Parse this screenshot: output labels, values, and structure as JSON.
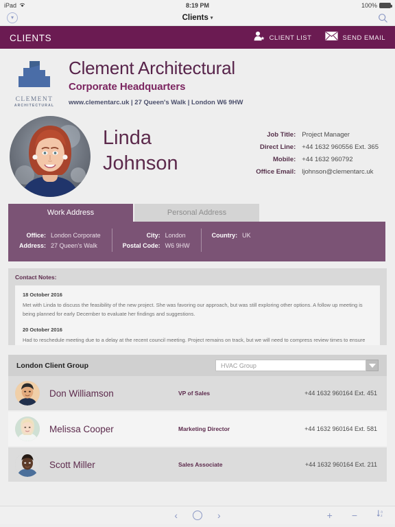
{
  "status_bar": {
    "device": "iPad",
    "wifi_icon": "wifi-icon",
    "time": "8:19 PM",
    "battery_percent": "100%"
  },
  "chrome": {
    "back_icon": "chevron-down-circle-icon",
    "title": "Clients",
    "title_caret": "▾",
    "search_icon": "search-icon"
  },
  "appbar": {
    "title": "CLIENTS",
    "actions": [
      {
        "label": "CLIENT LIST",
        "icon": "client-list-person-icon"
      },
      {
        "label": "SEND EMAIL",
        "icon": "envelope-icon"
      }
    ]
  },
  "company": {
    "logo_icon": "building-logo-icon",
    "logo_word_1": "CLEMENT",
    "logo_word_2": "ARCHITECTURAL",
    "name": "Clement Architectural",
    "subtitle": "Corporate Headquarters",
    "meta": "www.clementarc.uk | 27 Queen's Walk | London W6 9HW"
  },
  "person": {
    "avatar_icon": "contact-photo-avatar",
    "first_name": "Linda",
    "last_name": "Johnson",
    "details": [
      {
        "key": "Job Title:",
        "value": "Project Manager"
      },
      {
        "key": "Direct Line:",
        "value": "+44 1632 960556  Ext. 365"
      },
      {
        "key": "Mobile:",
        "value": "+44 1632 960792"
      },
      {
        "key": "Office Email:",
        "value": "ljohnson@clementarc.uk"
      }
    ]
  },
  "address": {
    "tabs": [
      {
        "label": "Work Address",
        "active": true
      },
      {
        "label": "Personal Address",
        "active": false
      }
    ],
    "columns": [
      {
        "rows": [
          {
            "key": "Office:",
            "value": "London Corporate"
          },
          {
            "key": "Address:",
            "value": "27 Queen's Walk"
          }
        ]
      },
      {
        "rows": [
          {
            "key": "City:",
            "value": "London"
          },
          {
            "key": "Postal Code:",
            "value": "W6 9HW"
          }
        ]
      },
      {
        "rows": [
          {
            "key": "Country:",
            "value": "UK"
          }
        ]
      }
    ]
  },
  "notes": {
    "label": "Contact Notes:",
    "entries": [
      {
        "date": "18 October 2016",
        "body": "Met with Linda to discuss the feasibility of the new project. She was favoring our approach, but was still exploring other options. A follow up meeting is being planned for early December to evaluate her findings and suggestions."
      },
      {
        "date": "20 October 2016",
        "body": "Had to reschedule meeting due to a delay at the recent council meeting. Project remains on track, but we will need to compress review times to ensure deadline is not"
      }
    ]
  },
  "client_group": {
    "title": "London Client Group",
    "select": {
      "value": "HVAC Group",
      "caret_icon": "chevron-down-icon"
    },
    "members": [
      {
        "avatar_icon": "member-photo-avatar",
        "name": "Don Williamson",
        "role": "VP of Sales",
        "phone": "+44 1632 960164  Ext. 451"
      },
      {
        "avatar_icon": "member-photo-avatar",
        "name": "Melissa Cooper",
        "role": "Marketing Director",
        "phone": "+44 1632 960164  Ext. 581"
      },
      {
        "avatar_icon": "member-photo-avatar",
        "name": "Scott Miller",
        "role": "Sales Associate",
        "phone": "+44 1632 960164  Ext. 211"
      }
    ]
  },
  "bottom_bar": {
    "prev_icon": "chevron-left-icon",
    "record_icon": "circle-icon",
    "next_icon": "chevron-right-icon",
    "add_icon": "plus-icon",
    "remove_icon": "minus-icon",
    "sort_icon": "sort-icon"
  },
  "colors": {
    "brand_purple": "#6b1b52",
    "panel_purple": "#7b5375",
    "heading_purple": "#57234a",
    "logo_blue": "#4a6da7",
    "ios_accent": "#8b98c4"
  }
}
